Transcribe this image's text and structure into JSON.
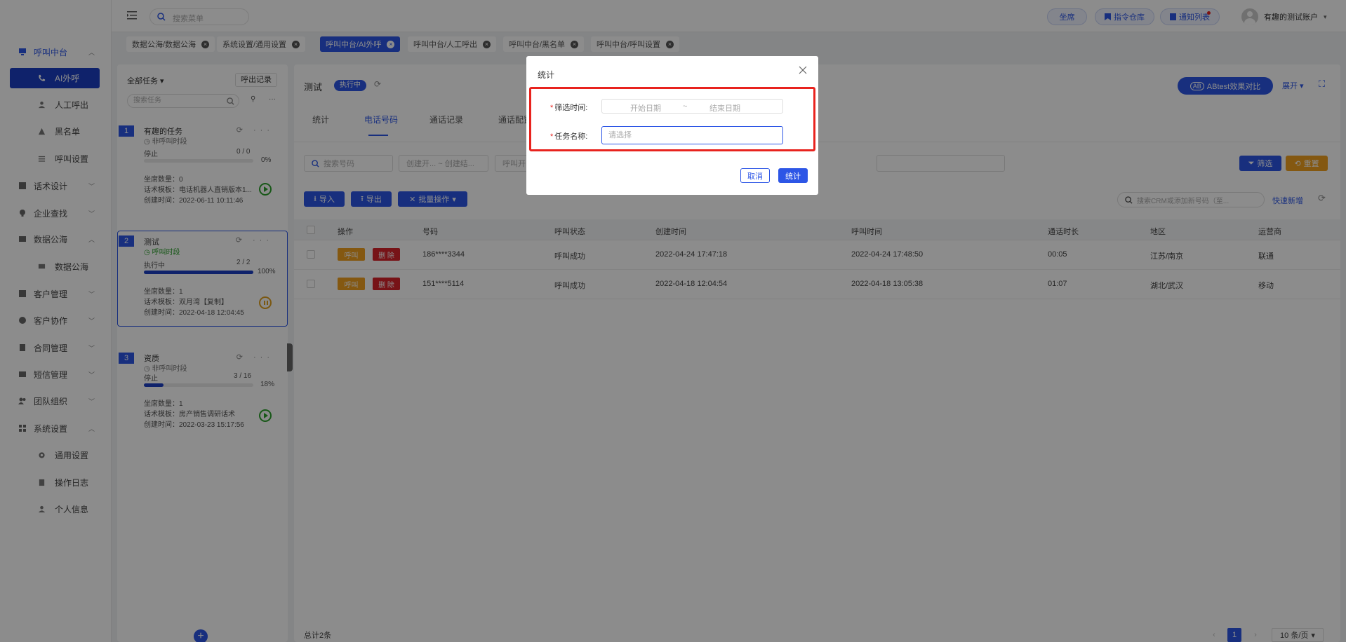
{
  "header": {
    "search_placeholder": "搜索菜单",
    "btn_seat": "坐席",
    "btn_command": "指令仓库",
    "btn_notify": "通知列表",
    "user_name": "有趣的测试账户"
  },
  "sidebar": {
    "items": [
      {
        "label": "呼叫中台",
        "icon": "phone-center-icon"
      },
      {
        "label": "AI外呼",
        "icon": "phone-icon"
      },
      {
        "label": "人工呼出",
        "icon": "person-icon"
      },
      {
        "label": "黑名单",
        "icon": "warning-icon"
      },
      {
        "label": "呼叫设置",
        "icon": "sliders-icon"
      },
      {
        "label": "话术设计",
        "icon": "script-icon"
      },
      {
        "label": "企业查找",
        "icon": "bulb-icon"
      },
      {
        "label": "数据公海",
        "icon": "data-icon"
      },
      {
        "label": "数据公海",
        "icon": "monitor-icon"
      },
      {
        "label": "客户管理",
        "icon": "customer-icon"
      },
      {
        "label": "客户协作",
        "icon": "collab-icon"
      },
      {
        "label": "合同管理",
        "icon": "contract-icon"
      },
      {
        "label": "短信管理",
        "icon": "sms-icon"
      },
      {
        "label": "团队组织",
        "icon": "team-icon"
      },
      {
        "label": "系统设置",
        "icon": "settings-grid-icon"
      },
      {
        "label": "通用设置",
        "icon": "gear-icon"
      },
      {
        "label": "操作日志",
        "icon": "log-icon"
      },
      {
        "label": "个人信息",
        "icon": "user-icon"
      }
    ]
  },
  "tabs": [
    {
      "label": "数据公海/数据公海"
    },
    {
      "label": "系统设置/通用设置"
    },
    {
      "label": "呼叫中台/AI外呼"
    },
    {
      "label": "呼叫中台/人工呼出"
    },
    {
      "label": "呼叫中台/黑名单"
    },
    {
      "label": "呼叫中台/呼叫设置"
    }
  ],
  "task_panel": {
    "filter_label": "全部任务",
    "outbound_record": "呼出记录",
    "search_placeholder": "搜索任务",
    "tasks": [
      {
        "num": "1",
        "name": "有趣的任务",
        "period": "非呼叫时段",
        "status": "停止",
        "count": "0 / 0",
        "percent": "0%",
        "progress": 0,
        "seats": "坐席数量：0",
        "template": "话术模板：电话机器人直销版本1...",
        "created": "创建时间：2022-06-11 10:11:46"
      },
      {
        "num": "2",
        "name": "测试",
        "period": "呼叫时段",
        "status": "执行中",
        "count": "2 / 2",
        "percent": "100%",
        "progress": 1,
        "seats": "坐席数量：1",
        "template": "话术模板：双月湾【复制】",
        "created": "创建时间：2022-04-18 12:04:45"
      },
      {
        "num": "3",
        "name": "资质",
        "period": "非呼叫时段",
        "status": "停止",
        "count": "3 / 16",
        "percent": "18%",
        "progress": 0.18,
        "seats": "坐席数量：1",
        "template": "话术模板：房产销售调研话术",
        "created": "创建时间：2022-03-23 15:17:56"
      }
    ]
  },
  "main": {
    "title": "测试",
    "status_badge": "执行中",
    "ab_button": "ABtest效果对比",
    "expand": "展开",
    "tabs": [
      "统计",
      "电话号码",
      "通话记录",
      "通话配置"
    ],
    "filters": {
      "search_number": "搜索号码",
      "create_range": "创建开... ~ 创建结...",
      "call_start": "呼叫开"
    },
    "btn_filter": "筛选",
    "btn_reset": "重置",
    "btn_import": "导入",
    "btn_export": "导出",
    "btn_batch": "批量操作",
    "crm_search_placeholder": "搜索CRM或添加新号码（至...",
    "quick_add": "快速新增",
    "columns": [
      "操作",
      "号码",
      "呼叫状态",
      "创建时间",
      "呼叫时间",
      "通话时长",
      "地区",
      "运营商"
    ],
    "rows": [
      {
        "btn_a": "呼叫",
        "btn_b": "删 除",
        "number": "186****3344",
        "status": "呼叫成功",
        "created": "2022-04-24 17:47:18",
        "called": "2022-04-24 17:48:50",
        "duration": "00:05",
        "region": "江苏/南京",
        "carrier": "联通"
      },
      {
        "btn_a": "呼叫",
        "btn_b": "删 除",
        "number": "151****5114",
        "status": "呼叫成功",
        "created": "2022-04-18 12:04:54",
        "called": "2022-04-18 13:05:38",
        "duration": "01:07",
        "region": "湖北/武汉",
        "carrier": "移动"
      }
    ],
    "total": "总计2条",
    "page": "1",
    "page_size": "10 条/页"
  },
  "modal": {
    "title": "统计",
    "label_time": "筛选时间:",
    "label_task": "任务名称:",
    "start_placeholder": "开始日期",
    "tilde": "~",
    "end_placeholder": "结束日期",
    "task_placeholder": "请选择",
    "cancel": "取消",
    "confirm": "统计"
  },
  "colors": {
    "primary": "#2d56e6",
    "dark_primary": "#1d3fc4",
    "orange": "#f0a020",
    "red": "#e8231e",
    "green": "#2ca02c"
  }
}
